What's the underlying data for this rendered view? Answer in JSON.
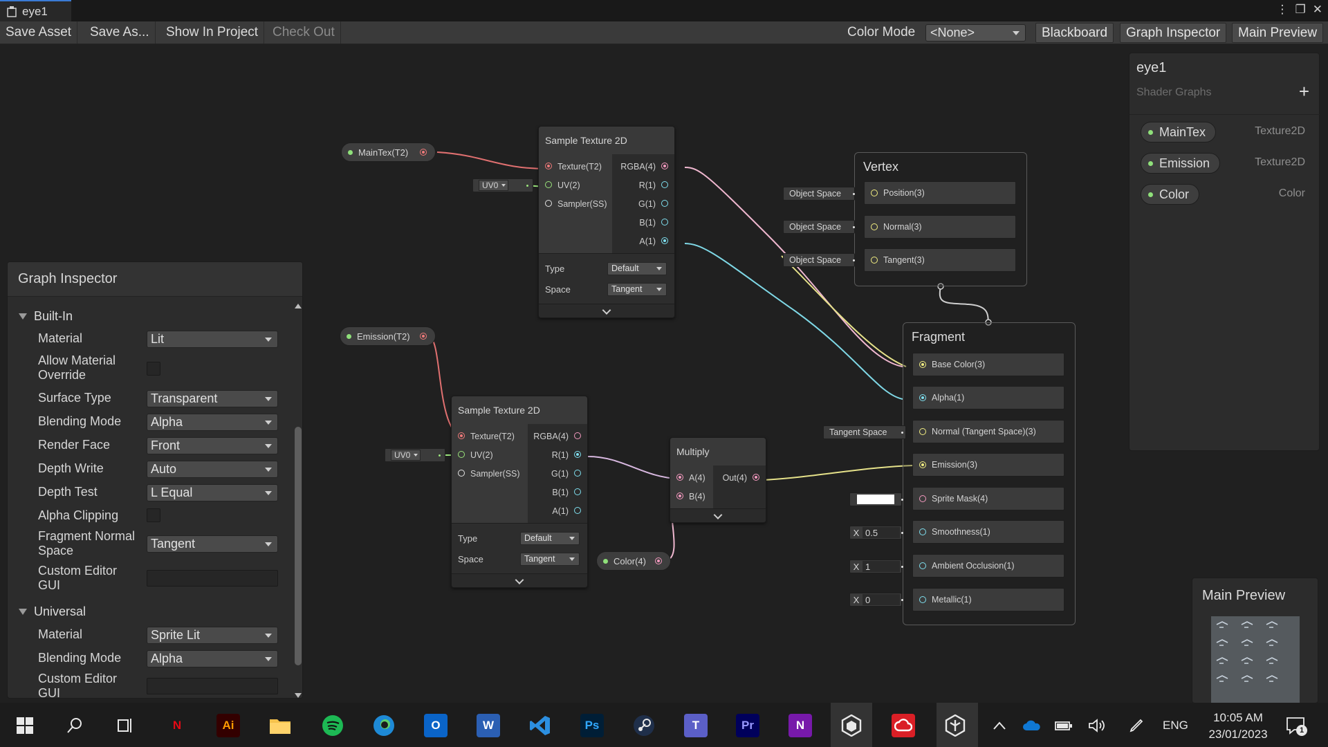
{
  "window": {
    "tab_title": "eye1"
  },
  "toolbar": {
    "save_asset": "Save Asset",
    "save_as": "Save As...",
    "show_in_project": "Show In Project",
    "check_out": "Check Out",
    "color_mode_label": "Color Mode",
    "color_mode_value": "<None>",
    "blackboard": "Blackboard",
    "graph_inspector": "Graph Inspector",
    "main_preview": "Main Preview"
  },
  "properties": {
    "maintex": "MainTex(T2)",
    "emission": "Emission(T2)",
    "color": "Color(4)"
  },
  "uv": {
    "label": "UV0"
  },
  "sample_top": {
    "title": "Sample Texture 2D",
    "inputs": [
      "Texture(T2)",
      "UV(2)",
      "Sampler(SS)"
    ],
    "outputs": [
      "RGBA(4)",
      "R(1)",
      "G(1)",
      "B(1)",
      "A(1)"
    ],
    "type_label": "Type",
    "type_value": "Default",
    "space_label": "Space",
    "space_value": "Tangent"
  },
  "sample_bottom": {
    "title": "Sample Texture 2D",
    "inputs": [
      "Texture(T2)",
      "UV(2)",
      "Sampler(SS)"
    ],
    "outputs": [
      "RGBA(4)",
      "R(1)",
      "G(1)",
      "B(1)",
      "A(1)"
    ],
    "type_label": "Type",
    "type_value": "Default",
    "space_label": "Space",
    "space_value": "Tangent"
  },
  "multiply": {
    "title": "Multiply",
    "inputs": [
      "A(4)",
      "B(4)"
    ],
    "outputs": [
      "Out(4)"
    ]
  },
  "vertex": {
    "title": "Vertex",
    "blocks": [
      "Position(3)",
      "Normal(3)",
      "Tangent(3)"
    ],
    "inline": [
      "Object Space",
      "Object Space",
      "Object Space"
    ]
  },
  "fragment": {
    "title": "Fragment",
    "blocks": [
      "Base Color(3)",
      "Alpha(1)",
      "Normal (Tangent Space)(3)",
      "Emission(3)",
      "Sprite Mask(4)",
      "Smoothness(1)",
      "Ambient Occlusion(1)",
      "Metallic(1)"
    ],
    "normal_space": "Tangent Space",
    "x_label": "X",
    "smoothness": "0.5",
    "ambient_occlusion": "1",
    "metallic": "0"
  },
  "inspector": {
    "title": "Graph Inspector",
    "builtin": {
      "section": "Built-In",
      "material_label": "Material",
      "material_value": "Lit",
      "allow_override_label": "Allow Material Override",
      "surface_type_label": "Surface Type",
      "surface_type_value": "Transparent",
      "blending_mode_label": "Blending Mode",
      "blending_mode_value": "Alpha",
      "render_face_label": "Render Face",
      "render_face_value": "Front",
      "depth_write_label": "Depth Write",
      "depth_write_value": "Auto",
      "depth_test_label": "Depth Test",
      "depth_test_value": "L Equal",
      "alpha_clipping_label": "Alpha Clipping",
      "fragment_normal_label": "Fragment Normal Space",
      "fragment_normal_value": "Tangent",
      "custom_editor_label": "Custom Editor GUI"
    },
    "universal": {
      "section": "Universal",
      "material_label": "Material",
      "material_value": "Sprite Lit",
      "blending_mode_label": "Blending Mode",
      "blending_mode_value": "Alpha",
      "custom_editor_label": "Custom Editor GUI"
    }
  },
  "blackboard": {
    "title": "eye1",
    "subtitle": "Shader Graphs",
    "items": [
      {
        "name": "MainTex",
        "type": "Texture2D"
      },
      {
        "name": "Emission",
        "type": "Texture2D"
      },
      {
        "name": "Color",
        "type": "Color"
      }
    ]
  },
  "preview": {
    "title": "Main Preview"
  },
  "taskbar": {
    "time": "10:05 AM",
    "date": "23/01/2023",
    "lang": "ENG",
    "notifications": "1",
    "icons": [
      "windows-start",
      "search",
      "task-view",
      "netflix",
      "illustrator",
      "file-explorer",
      "spotify",
      "edge",
      "outlook",
      "word",
      "vscode",
      "photoshop",
      "steam",
      "teams",
      "premiere",
      "onenote",
      "unity-hub",
      "creative-cloud",
      "unity"
    ]
  },
  "colors": {
    "accent": "#3a7bd5",
    "texture_wire": "#e07070",
    "vector4_wire": "#f0b8d0",
    "float_wire": "#7fd8e6",
    "vector3_wire": "#e6e28a",
    "vector2_wire": "#9be57c"
  }
}
